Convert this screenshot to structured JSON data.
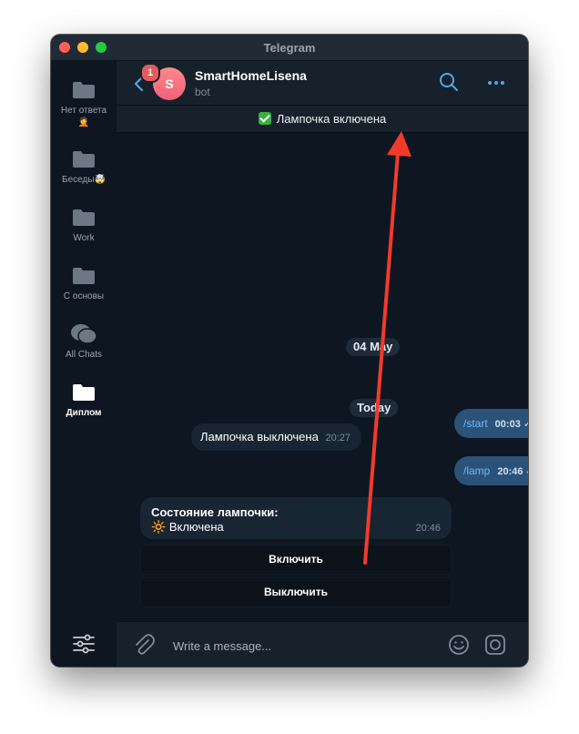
{
  "window": {
    "title": "Telegram"
  },
  "sidebar": {
    "folders": [
      {
        "label": "Нет ответа",
        "emoji": "🤦"
      },
      {
        "label": "Беседы",
        "emoji": "🤯"
      },
      {
        "label": "Work",
        "emoji": ""
      },
      {
        "label": "С основы",
        "emoji": ""
      },
      {
        "label": "All Chats",
        "emoji": ""
      },
      {
        "label": "Диплом",
        "emoji": ""
      }
    ]
  },
  "header": {
    "unread_count": "1",
    "avatar_letter": "S",
    "chat_title": "SmartHomeLisena",
    "chat_subtitle": "bot"
  },
  "pinned": {
    "text": "Лампочка включена"
  },
  "messages": {
    "date1": "04 May",
    "start_cmd": "/start",
    "start_time": "00:03",
    "date2": "Today",
    "off_text": "Лампочка выключена",
    "off_time": "20:27",
    "lamp_cmd": "/lamp",
    "lamp_time": "20:46",
    "status_title": "Состояние лампочки:",
    "status_value": "Включена",
    "status_emoji": "🔆",
    "status_time": "20:46",
    "ticks": "✓✓"
  },
  "keyboard": {
    "on_label": "Включить",
    "off_label": "Выключить"
  },
  "composer": {
    "placeholder": "Write a message..."
  },
  "colors": {
    "accent": "#4fa8e8",
    "annotation_arrow": "#f23a2b",
    "outgoing_bubble": "#2b5278",
    "incoming_bubble": "#182533"
  }
}
